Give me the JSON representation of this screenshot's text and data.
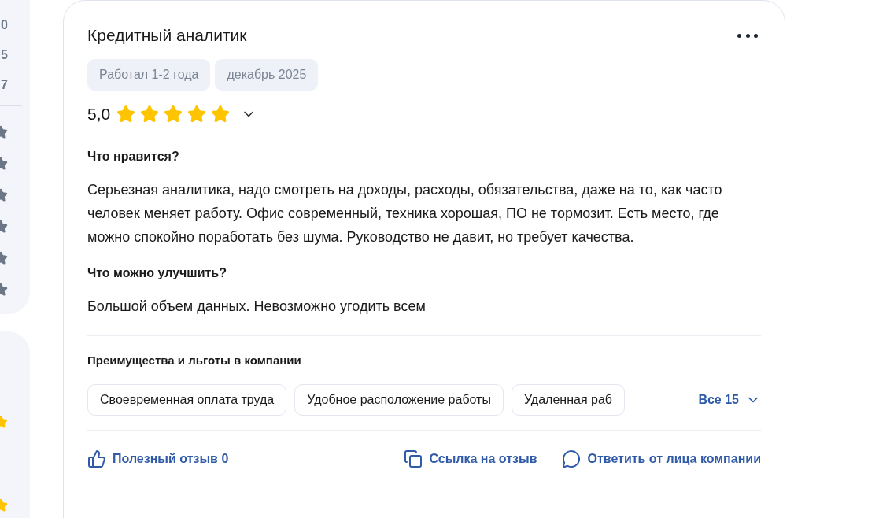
{
  "sidebar": {
    "values": [
      "0",
      "5",
      "7"
    ]
  },
  "review": {
    "title": "Кредитный аналитик",
    "tags": [
      "Работал 1-2 года",
      "декабрь 2025"
    ],
    "rating": "5,0",
    "stars": 5,
    "expanded": false,
    "sections": [
      {
        "heading": "Что нравится?",
        "text": "Серьезная аналитика, надо смотреть на доходы, расходы, обязательства, даже на то, как часто человек меняет работу. Офис современный, техника хорошая, ПО не тормозит. Есть место, где можно спокойно поработать без шума. Руководство не давит, но требует качества."
      },
      {
        "heading": "Что можно улучшить?",
        "text": "Большой объем данных. Невозможно угодить всем"
      }
    ],
    "benefits": {
      "heading": "Преимущества и льготы в компании",
      "items": [
        "Своевременная оплата труда",
        "Удобное расположение работы",
        "Удаленная раб"
      ],
      "all": "Все 15"
    },
    "actions": [
      {
        "kind": "like",
        "label": "Полезный отзыв 0"
      },
      {
        "kind": "link",
        "label": "Ссылка на отзыв"
      },
      {
        "kind": "reply",
        "label": "Ответить от лица компании"
      }
    ]
  }
}
